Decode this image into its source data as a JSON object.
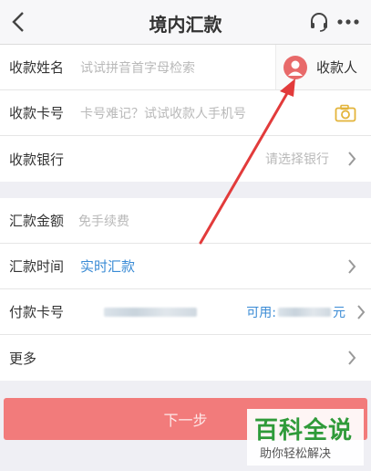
{
  "header": {
    "title": "境内汇款",
    "back_icon": "chevron-left-icon",
    "service_icon": "headset-icon",
    "more_icon": "more-dots-icon"
  },
  "payee": {
    "name_label": "收款姓名",
    "name_placeholder": "试试拼音首字母检索",
    "payee_button": "收款人",
    "card_label": "收款卡号",
    "card_placeholder": "卡号难记？试试收款人手机号",
    "camera_icon": "camera-icon",
    "bank_label": "收款银行",
    "bank_placeholder": "请选择银行"
  },
  "transfer": {
    "amount_label": "汇款金额",
    "amount_placeholder": "免手续费",
    "time_label": "汇款时间",
    "time_value": "实时汇款",
    "pay_card_label": "付款卡号",
    "available_label": "可用:",
    "available_suffix": "元",
    "more_label": "更多"
  },
  "actions": {
    "next_label": "下一步"
  },
  "watermark": {
    "main": "百科全说",
    "sub": "助你轻松解决"
  },
  "colors": {
    "accent_blue": "#3a8bd5",
    "button_red": "#f27b7b",
    "arrow_red": "#e23b3b",
    "watermark_green": "#2f9a39"
  }
}
